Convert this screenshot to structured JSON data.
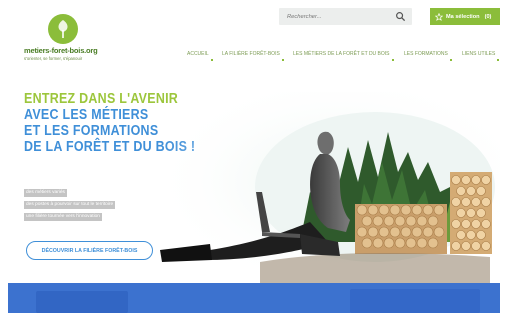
{
  "brand": {
    "name": "metiers-foret-bois.org",
    "tagline": "s'orienter, se former, s'épanouir",
    "accent": "#8bbd3a",
    "blue": "#3f8fd8"
  },
  "search": {
    "placeholder": "Rechercher..."
  },
  "selection": {
    "label": "Ma sélection",
    "count": "(0)"
  },
  "nav": {
    "items": [
      "ACCUEIL",
      "LA FILIÈRE FORÊT-BOIS",
      "LES MÉTIERS DE LA FORÊT ET DU BOIS",
      "LES FORMATIONS",
      "LIENS UTILES"
    ]
  },
  "hero": {
    "line1": "ENTREZ DANS L'AVENIR",
    "line2": "AVEC LES MÉTIERS",
    "line3": "ET LES FORMATIONS",
    "line4": "DE LA FORÊT ET DU BOIS !",
    "tags": [
      "des métiers variés",
      "des postes à pourvoir sur tout le territoire",
      "une filière tournée vers l'innovation"
    ],
    "cta": "DÉCOUVRIR LA FILIÈRE FORÊT-BOIS"
  },
  "icons": {
    "logo": "tree-leaf-icon",
    "search": "search-icon",
    "selection": "star-icon"
  }
}
